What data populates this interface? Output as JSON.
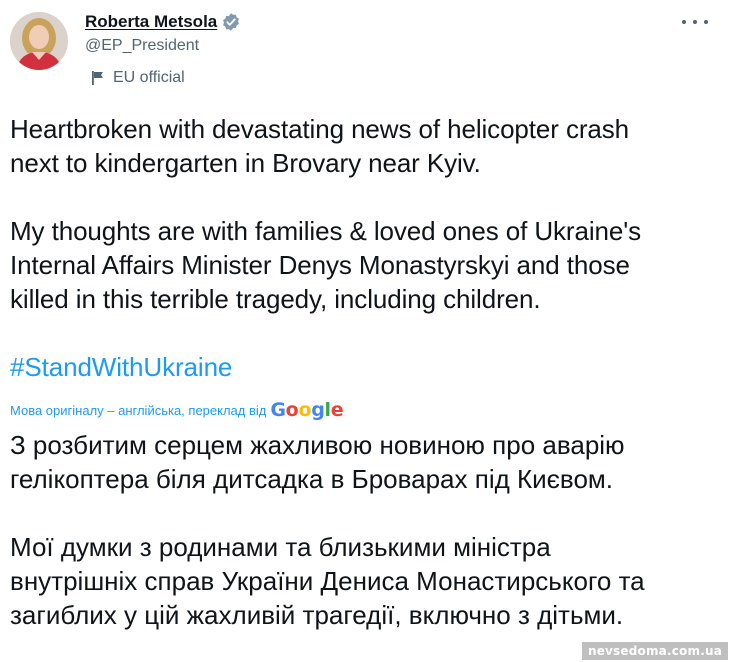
{
  "author": {
    "display_name": "Roberta Metsola",
    "handle": "@EP_President",
    "affiliation": "EU official",
    "verified": true
  },
  "icons": {
    "verified": "verified-badge-icon",
    "affiliation": "flag-icon",
    "more": "more-options-icon"
  },
  "tweet": {
    "paragraph1": "Heartbroken with devastating news of helicopter crash\nnext to kindergarten in Brovary near Kyiv.",
    "paragraph2": "My thoughts are with families & loved ones of Ukraine's\nInternal Affairs Minister Denys Monastyrskyi and those\nkilled in this terrible tragedy, including children.",
    "hashtag": "#StandWithUkraine"
  },
  "translation": {
    "note": "Мова оригіналу – англійська, переклад від",
    "provider": "Google",
    "paragraph1": "З розбитим серцем жахливою новиною про аварію\nгелікоптера біля дитсадка в Броварах під Києвом.",
    "paragraph2": "Мої думки з родинами та близькими міністра\nвнутрішніх справ України Дениса Монастирського та\nзагиблих у цій жахливій трагедії, включно з дітьми."
  },
  "watermark": "nevsedoma.com.ua",
  "colors": {
    "link": "#1d9bf0",
    "secondary_text": "#536471",
    "primary_text": "#0f1419",
    "google_blue": "#4285F4",
    "google_red": "#EA4335",
    "google_yellow": "#FBBC05",
    "google_green": "#34A853"
  }
}
